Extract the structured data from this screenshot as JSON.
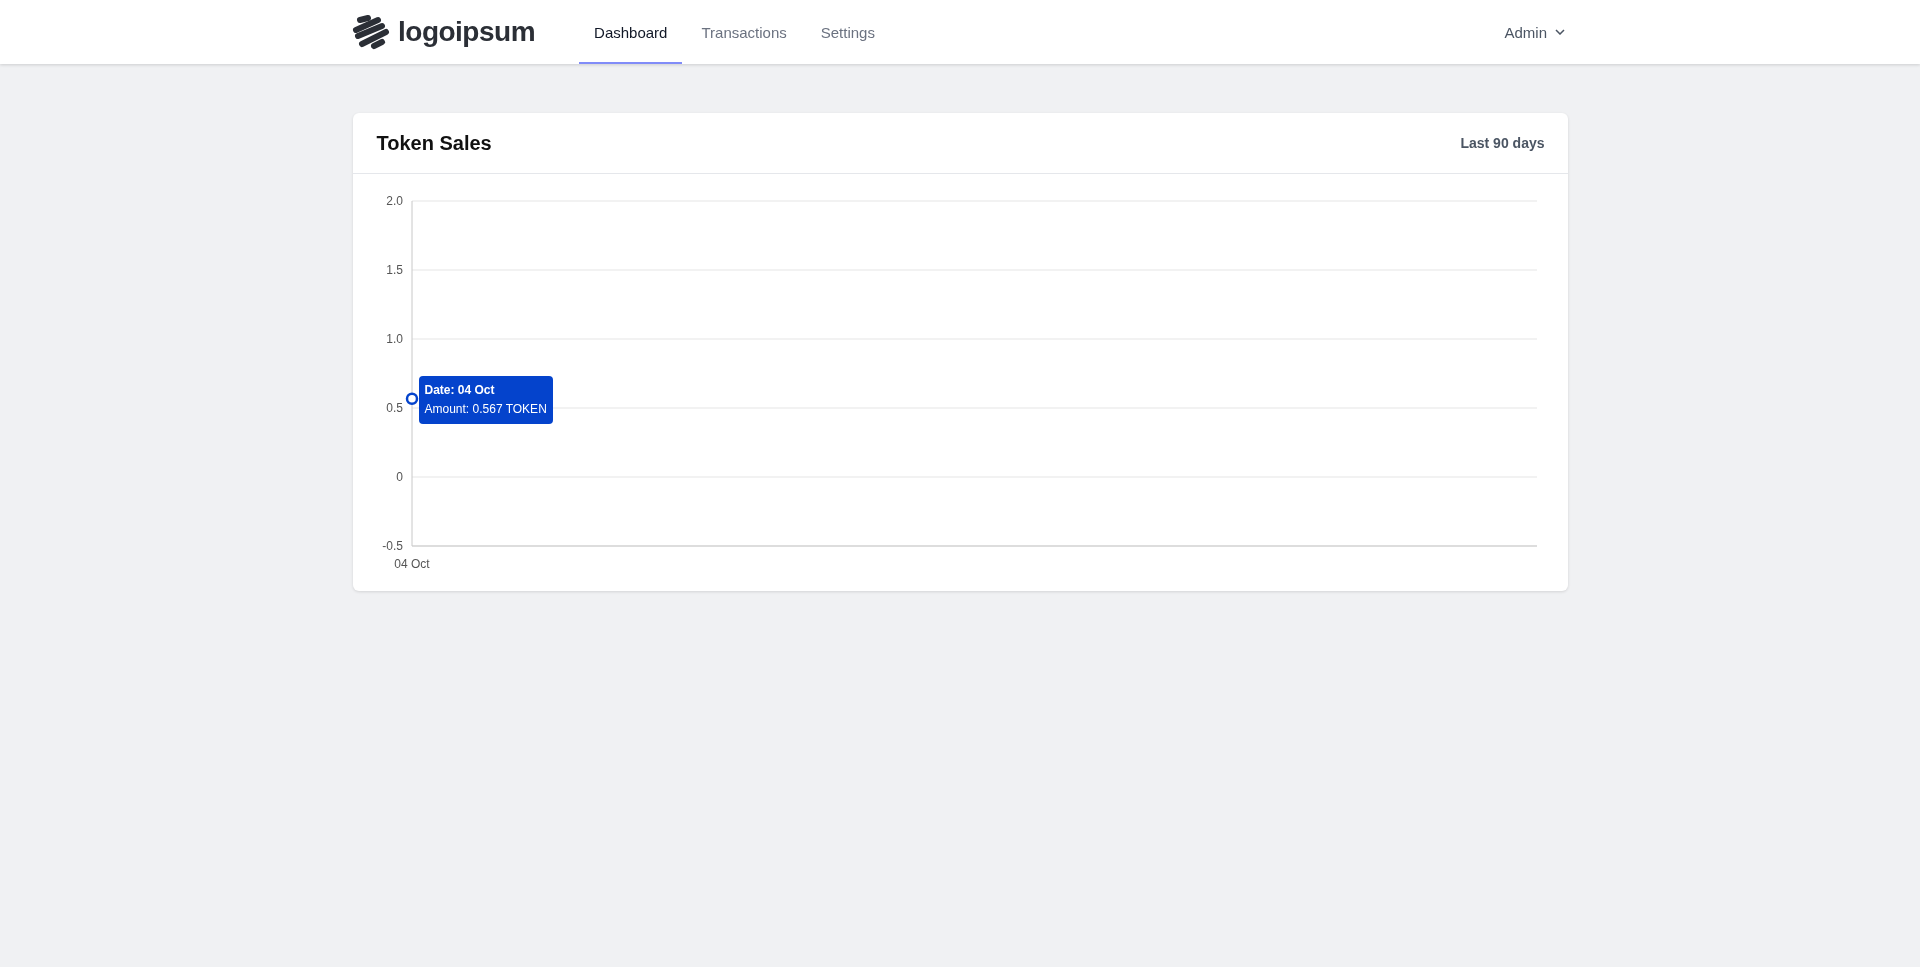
{
  "header": {
    "logo": "logoipsum",
    "nav": [
      {
        "label": "Dashboard",
        "selected": true
      },
      {
        "label": "Transactions",
        "selected": false
      },
      {
        "label": "Settings",
        "selected": false
      }
    ],
    "user_menu": "Admin"
  },
  "card": {
    "title": "Token Sales",
    "period": "Last 90 days",
    "chart_data": {
      "type": "line",
      "categories": [
        "04 Oct"
      ],
      "grid": true,
      "series": [
        {
          "color": "#0443cc",
          "marker": "circle",
          "values": [
            0.567
          ]
        }
      ],
      "ylim": [
        -0.5,
        2
      ],
      "yticks": [
        {
          "value": -0.5,
          "label": "-0.5"
        },
        {
          "value": 0,
          "label": "0"
        },
        {
          "value": 0.5,
          "label": "0.5"
        },
        {
          "value": 1,
          "label": "1.0"
        },
        {
          "value": 1.5,
          "label": "1.5"
        },
        {
          "value": 2,
          "label": "2.0"
        }
      ]
    },
    "tooltip": {
      "title": "Date: 04 Oct",
      "body": "Amount: 0.567 TOKEN"
    }
  }
}
